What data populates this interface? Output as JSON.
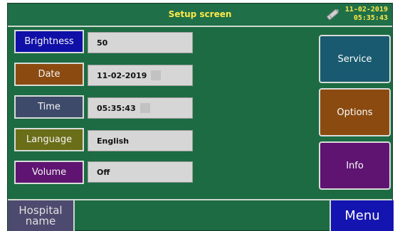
{
  "header": {
    "title": "Setup screen",
    "date": "11-02-2019",
    "time": "05:35:43",
    "icon": "pen-icon",
    "text_color": "#ffe84a"
  },
  "settings": [
    {
      "label": "Brightness",
      "value": "50",
      "color": "#1010a8"
    },
    {
      "label": "Date",
      "value": "11-02-2019",
      "color": "#8a4a10"
    },
    {
      "label": "Time",
      "value": "05:35:43",
      "color": "#3e4a6a"
    },
    {
      "label": "Language",
      "value": "English",
      "color": "#6b6e18"
    },
    {
      "label": "Volume",
      "value": "Off",
      "color": "#5e1470"
    }
  ],
  "side_buttons": [
    {
      "label": "Service",
      "color": "#1a5a70"
    },
    {
      "label": "Options",
      "color": "#8a4a10"
    },
    {
      "label": "Info",
      "color": "#5e1470"
    }
  ],
  "footer": {
    "hospital_label": "Hospital name",
    "menu_label": "Menu"
  },
  "colors": {
    "screen_bg": "#1c6b43"
  }
}
